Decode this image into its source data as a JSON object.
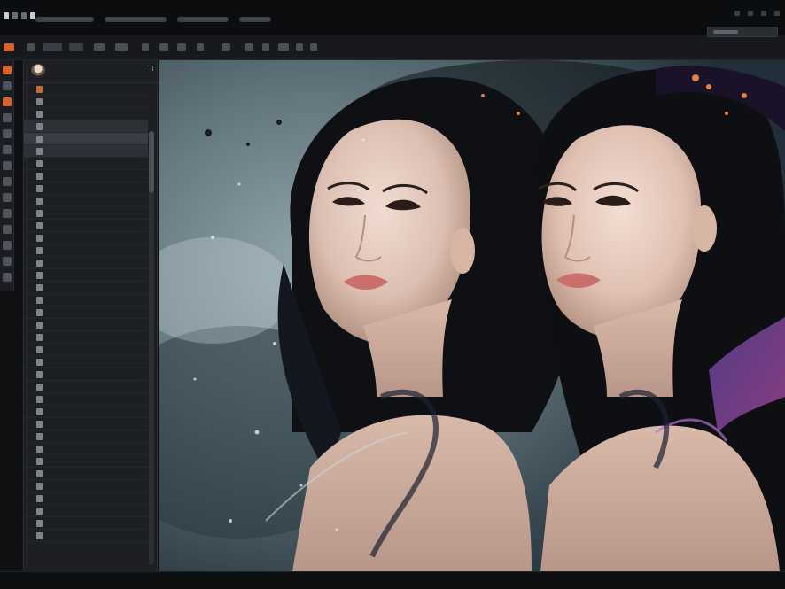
{
  "app": {
    "accent_color": "#d9622b",
    "background_color": "#101113",
    "panel_color": "#1d1f23"
  },
  "menubar": {
    "items_count_hint": 6
  },
  "toolbar": {
    "options": [
      "opt-1",
      "opt-2",
      "opt-3",
      "opt-4",
      "opt-5",
      "opt-6",
      "opt-7",
      "opt-8",
      "opt-9",
      "opt-10",
      "opt-11",
      "opt-12",
      "opt-13",
      "opt-14"
    ]
  },
  "tools": {
    "icons": [
      "move-icon",
      "marquee-icon",
      "lasso-icon",
      "crop-icon",
      "brush-icon",
      "eraser-icon",
      "clone-icon",
      "gradient-icon",
      "pen-icon",
      "text-icon",
      "shape-icon",
      "hand-icon",
      "zoom-icon",
      "foreground-color-icon"
    ]
  },
  "panel": {
    "title": "",
    "layers": [
      {
        "icon": "folder-icon",
        "selected": false
      },
      {
        "icon": "layer-icon",
        "selected": false
      },
      {
        "icon": "layer-icon",
        "selected": false
      },
      {
        "icon": "layer-icon",
        "selected": true
      },
      {
        "icon": "layer-icon",
        "selected": true
      },
      {
        "icon": "layer-icon",
        "selected": true
      },
      {
        "icon": "layer-icon",
        "selected": false
      },
      {
        "icon": "layer-icon",
        "selected": false
      },
      {
        "icon": "layer-icon",
        "selected": false
      },
      {
        "icon": "layer-icon",
        "selected": false
      },
      {
        "icon": "layer-icon",
        "selected": false
      },
      {
        "icon": "layer-icon",
        "selected": false
      },
      {
        "icon": "layer-icon",
        "selected": false
      },
      {
        "icon": "layer-icon",
        "selected": false
      },
      {
        "icon": "layer-icon",
        "selected": false
      },
      {
        "icon": "layer-icon",
        "selected": false
      },
      {
        "icon": "layer-icon",
        "selected": false
      },
      {
        "icon": "layer-icon",
        "selected": false
      },
      {
        "icon": "layer-icon",
        "selected": false
      },
      {
        "icon": "layer-icon",
        "selected": false
      },
      {
        "icon": "layer-icon",
        "selected": false
      },
      {
        "icon": "layer-icon",
        "selected": false
      },
      {
        "icon": "layer-icon",
        "selected": false
      },
      {
        "icon": "layer-icon",
        "selected": false
      },
      {
        "icon": "layer-icon",
        "selected": false
      },
      {
        "icon": "layer-icon",
        "selected": false
      },
      {
        "icon": "layer-icon",
        "selected": false
      },
      {
        "icon": "layer-icon",
        "selected": false
      },
      {
        "icon": "layer-icon",
        "selected": false
      },
      {
        "icon": "layer-icon",
        "selected": false
      },
      {
        "icon": "layer-icon",
        "selected": false
      },
      {
        "icon": "layer-icon",
        "selected": false
      },
      {
        "icon": "layer-icon",
        "selected": false
      },
      {
        "icon": "layer-icon",
        "selected": false
      },
      {
        "icon": "layer-icon",
        "selected": false
      },
      {
        "icon": "layer-icon",
        "selected": false
      },
      {
        "icon": "layer-icon",
        "selected": false
      }
    ]
  },
  "status": {
    "left": "",
    "right": ""
  }
}
